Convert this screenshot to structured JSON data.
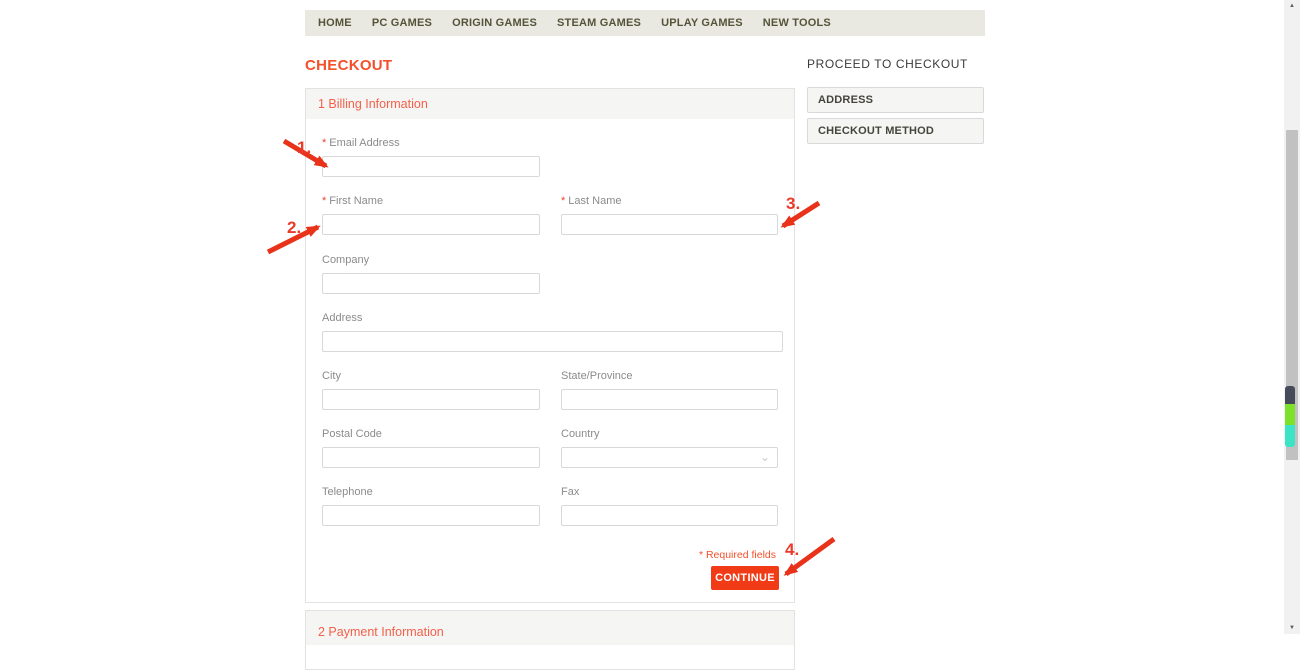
{
  "nav": {
    "items": [
      "HOME",
      "PC GAMES",
      "ORIGIN GAMES",
      "STEAM GAMES",
      "UPLAY GAMES",
      "NEW TOOLS"
    ]
  },
  "page": {
    "title": "CHECKOUT"
  },
  "billing": {
    "section_title": "1 Billing Information",
    "required_marker": "*",
    "fields": {
      "email": {
        "label": "Email Address",
        "required": true,
        "value": ""
      },
      "first_name": {
        "label": "First Name",
        "required": true,
        "value": ""
      },
      "last_name": {
        "label": "Last Name",
        "required": true,
        "value": ""
      },
      "company": {
        "label": "Company",
        "required": false,
        "value": ""
      },
      "address": {
        "label": "Address",
        "required": false,
        "value": ""
      },
      "city": {
        "label": "City",
        "required": false,
        "value": ""
      },
      "state": {
        "label": "State/Province",
        "required": false,
        "value": ""
      },
      "postal": {
        "label": "Postal Code",
        "required": false,
        "value": ""
      },
      "country": {
        "label": "Country",
        "required": false,
        "value": ""
      },
      "telephone": {
        "label": "Telephone",
        "required": false,
        "value": ""
      },
      "fax": {
        "label": "Fax",
        "required": false,
        "value": ""
      }
    },
    "required_note": "* Required fields",
    "continue_label": "CONTINUE"
  },
  "payment": {
    "section_title": "2 Payment Information"
  },
  "sidebar": {
    "heading": "PROCEED TO CHECKOUT",
    "steps": [
      "ADDRESS",
      "CHECKOUT METHOD"
    ]
  },
  "annotations": [
    {
      "label": "1."
    },
    {
      "label": "2."
    },
    {
      "label": "3."
    },
    {
      "label": "4."
    }
  ],
  "icons": {
    "chevron_down": "⌄",
    "scroll_up": "▲",
    "scroll_down": "▼"
  },
  "colors": {
    "accent": "#f4502a",
    "button": "#f13b17",
    "arrow": "#e8321a",
    "nav_bg": "#e9e9e1",
    "section_header_bg": "#f5f5f4"
  }
}
